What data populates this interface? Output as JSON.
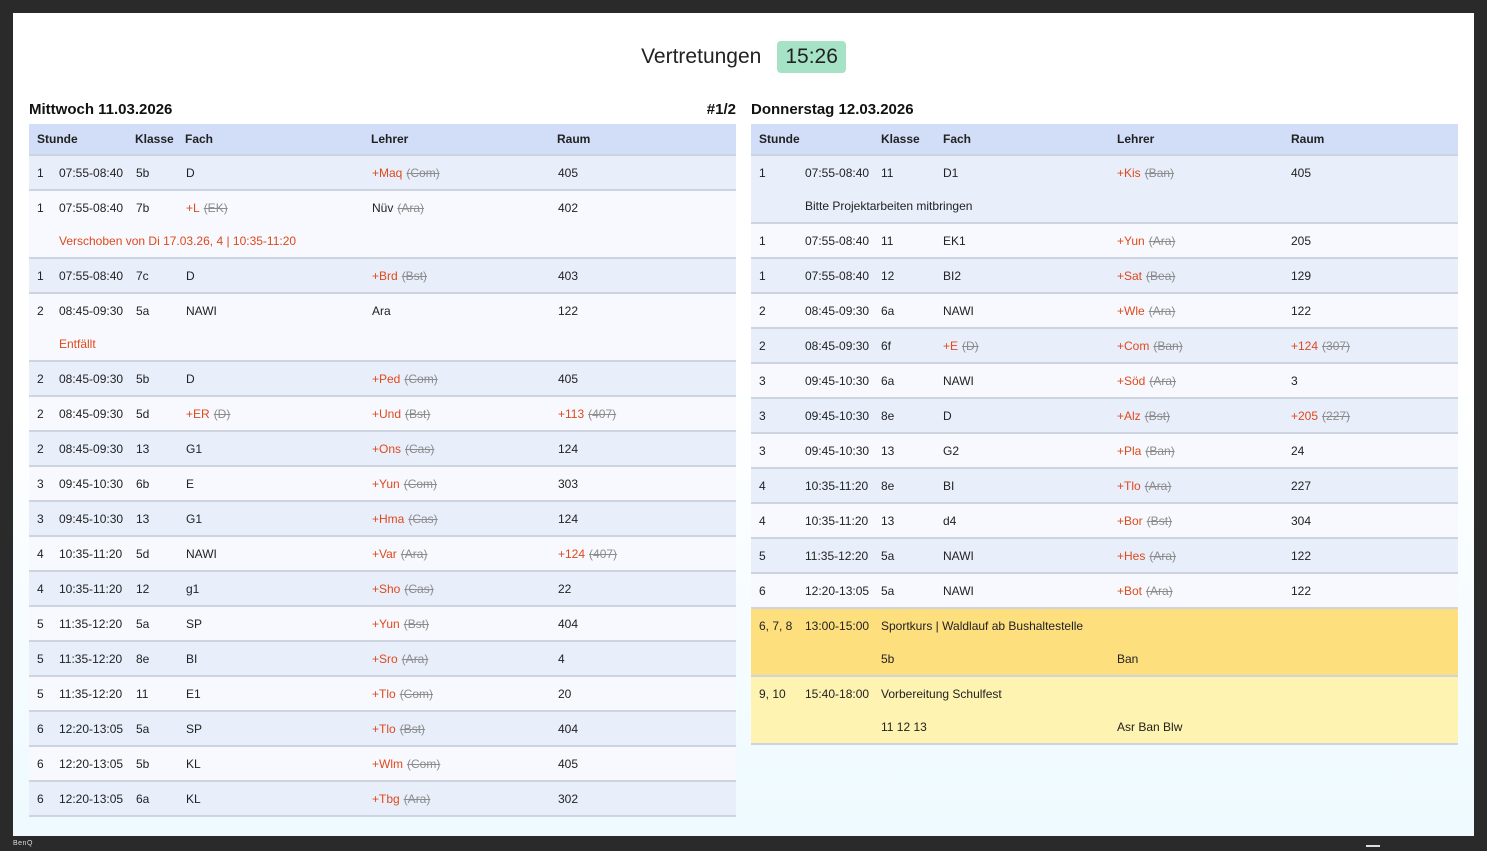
{
  "header": {
    "title": "Vertretungen",
    "clock": "15:26"
  },
  "brand": "BenQ",
  "left": {
    "day": "Mittwoch 11.03.2026",
    "page": "#1/2",
    "columns": {
      "stunde": "Stunde",
      "klasse": "Klasse",
      "fach": "Fach",
      "lehrer": "Lehrer",
      "raum": "Raum"
    },
    "rows": [
      {
        "h": "1",
        "t": "07:55-08:40",
        "k": "5b",
        "f": "D",
        "fo": "",
        "l": "+Maq",
        "lo": "(Com)",
        "r": "405",
        "ro": "",
        "n": ""
      },
      {
        "h": "1",
        "t": "07:55-08:40",
        "k": "7b",
        "f": "+L",
        "fo": "(EK)",
        "l": "Nüv",
        "lo": "(Ara)",
        "lplain": true,
        "r": "402",
        "ro": "",
        "n": "Verschoben von Di 17.03.26, 4 | 10:35-11:20"
      },
      {
        "h": "1",
        "t": "07:55-08:40",
        "k": "7c",
        "f": "D",
        "fo": "",
        "l": "+Brd",
        "lo": "(Bst)",
        "r": "403",
        "ro": "",
        "n": ""
      },
      {
        "h": "2",
        "t": "08:45-09:30",
        "k": "5a",
        "f": "NAWI",
        "fo": "",
        "l": "Ara",
        "lo": "",
        "lplain": true,
        "r": "122",
        "ro": "",
        "n": "Entfällt"
      },
      {
        "h": "2",
        "t": "08:45-09:30",
        "k": "5b",
        "f": "D",
        "fo": "",
        "l": "+Ped",
        "lo": "(Com)",
        "r": "405",
        "ro": "",
        "n": ""
      },
      {
        "h": "2",
        "t": "08:45-09:30",
        "k": "5d",
        "f": "+ER",
        "fo": "(D)",
        "l": "+Und",
        "lo": "(Bst)",
        "r": "+113",
        "ro": "(407)",
        "n": ""
      },
      {
        "h": "2",
        "t": "08:45-09:30",
        "k": "13",
        "f": "G1",
        "fo": "",
        "l": "+Ons",
        "lo": "(Cas)",
        "r": "124",
        "ro": "",
        "n": ""
      },
      {
        "h": "3",
        "t": "09:45-10:30",
        "k": "6b",
        "f": "E",
        "fo": "",
        "l": "+Yun",
        "lo": "(Com)",
        "r": "303",
        "ro": "",
        "n": ""
      },
      {
        "h": "3",
        "t": "09:45-10:30",
        "k": "13",
        "f": "G1",
        "fo": "",
        "l": "+Hma",
        "lo": "(Cas)",
        "r": "124",
        "ro": "",
        "n": ""
      },
      {
        "h": "4",
        "t": "10:35-11:20",
        "k": "5d",
        "f": "NAWI",
        "fo": "",
        "l": "+Var",
        "lo": "(Ara)",
        "r": "+124",
        "ro": "(407)",
        "n": ""
      },
      {
        "h": "4",
        "t": "10:35-11:20",
        "k": "12",
        "f": "g1",
        "fo": "",
        "l": "+Sho",
        "lo": "(Cas)",
        "r": "22",
        "ro": "",
        "n": ""
      },
      {
        "h": "5",
        "t": "11:35-12:20",
        "k": "5a",
        "f": "SP",
        "fo": "",
        "l": "+Yun",
        "lo": "(Bst)",
        "r": "404",
        "ro": "",
        "n": ""
      },
      {
        "h": "5",
        "t": "11:35-12:20",
        "k": "8e",
        "f": "BI",
        "fo": "",
        "l": "+Sro",
        "lo": "(Ara)",
        "r": "4",
        "ro": "",
        "n": ""
      },
      {
        "h": "5",
        "t": "11:35-12:20",
        "k": "11",
        "f": "E1",
        "fo": "",
        "l": "+Tlo",
        "lo": "(Com)",
        "r": "20",
        "ro": "",
        "n": ""
      },
      {
        "h": "6",
        "t": "12:20-13:05",
        "k": "5a",
        "f": "SP",
        "fo": "",
        "l": "+Tlo",
        "lo": "(Bst)",
        "r": "404",
        "ro": "",
        "n": ""
      },
      {
        "h": "6",
        "t": "12:20-13:05",
        "k": "5b",
        "f": "KL",
        "fo": "",
        "l": "+Wlm",
        "lo": "(Com)",
        "r": "405",
        "ro": "",
        "n": ""
      },
      {
        "h": "6",
        "t": "12:20-13:05",
        "k": "6a",
        "f": "KL",
        "fo": "",
        "l": "+Tbg",
        "lo": "(Ara)",
        "r": "302",
        "ro": "",
        "n": ""
      }
    ]
  },
  "right": {
    "day": "Donnerstag 12.03.2026",
    "columns": {
      "stunde": "Stunde",
      "klasse": "Klasse",
      "fach": "Fach",
      "lehrer": "Lehrer",
      "raum": "Raum"
    },
    "rows": [
      {
        "h": "1",
        "t": "07:55-08:40",
        "k": "11",
        "f": "D1",
        "fo": "",
        "l": "+Kis",
        "lo": "(Ban)",
        "r": "405",
        "ro": "",
        "n": "Bitte Projektarbeiten mitbringen",
        "nplain": true
      },
      {
        "h": "1",
        "t": "07:55-08:40",
        "k": "11",
        "f": "EK1",
        "fo": "",
        "l": "+Yun",
        "lo": "(Ara)",
        "r": "205",
        "ro": "",
        "n": ""
      },
      {
        "h": "1",
        "t": "07:55-08:40",
        "k": "12",
        "f": "BI2",
        "fo": "",
        "l": "+Sat",
        "lo": "(Bea)",
        "r": "129",
        "ro": "",
        "n": ""
      },
      {
        "h": "2",
        "t": "08:45-09:30",
        "k": "6a",
        "f": "NAWI",
        "fo": "",
        "l": "+Wle",
        "lo": "(Ara)",
        "r": "122",
        "ro": "",
        "n": ""
      },
      {
        "h": "2",
        "t": "08:45-09:30",
        "k": "6f",
        "f": "+E",
        "fo": "(D)",
        "l": "+Com",
        "lo": "(Ban)",
        "r": "+124",
        "ro": "(307)",
        "n": ""
      },
      {
        "h": "3",
        "t": "09:45-10:30",
        "k": "6a",
        "f": "NAWI",
        "fo": "",
        "l": "+Söd",
        "lo": "(Ara)",
        "r": "3",
        "ro": "",
        "n": ""
      },
      {
        "h": "3",
        "t": "09:45-10:30",
        "k": "8e",
        "f": "D",
        "fo": "",
        "l": "+Alz",
        "lo": "(Bst)",
        "r": "+205",
        "ro": "(227)",
        "n": ""
      },
      {
        "h": "3",
        "t": "09:45-10:30",
        "k": "13",
        "f": "G2",
        "fo": "",
        "l": "+Pla",
        "lo": "(Ban)",
        "r": "24",
        "ro": "",
        "n": ""
      },
      {
        "h": "4",
        "t": "10:35-11:20",
        "k": "8e",
        "f": "BI",
        "fo": "",
        "l": "+Tlo",
        "lo": "(Ara)",
        "r": "227",
        "ro": "",
        "n": ""
      },
      {
        "h": "4",
        "t": "10:35-11:20",
        "k": "13",
        "f": "d4",
        "fo": "",
        "l": "+Bor",
        "lo": "(Bst)",
        "r": "304",
        "ro": "",
        "n": ""
      },
      {
        "h": "5",
        "t": "11:35-12:20",
        "k": "5a",
        "f": "NAWI",
        "fo": "",
        "l": "+Hes",
        "lo": "(Ara)",
        "r": "122",
        "ro": "",
        "n": ""
      },
      {
        "h": "6",
        "t": "12:20-13:05",
        "k": "5a",
        "f": "NAWI",
        "fo": "",
        "l": "+Bot",
        "lo": "(Ara)",
        "r": "122",
        "ro": "",
        "n": ""
      }
    ],
    "events": [
      {
        "h": "6, 7, 8",
        "t": "13:00-15:00",
        "title": "Sportkurs | Waldlauf ab Bushaltestelle",
        "classes": "5b",
        "teachers": "Ban",
        "color": "#fddf7e"
      },
      {
        "h": "9, 10",
        "t": "15:40-18:00",
        "title": "Vorbereitung Schulfest",
        "classes": "11 12 13",
        "teachers": "Asr Ban Blw",
        "color": "#fef3b0"
      }
    ]
  }
}
